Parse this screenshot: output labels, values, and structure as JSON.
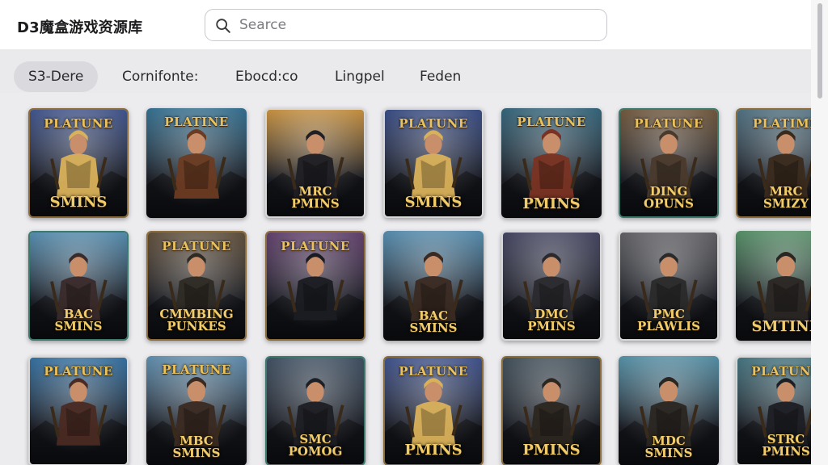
{
  "app": {
    "title": "D3魔盒游戏资源库"
  },
  "search": {
    "placeholder": "Searce",
    "value": ""
  },
  "tabs": [
    {
      "label": "S3-Dere",
      "active": true
    },
    {
      "label": "Cornifonte:",
      "active": false
    },
    {
      "label": "Ebocd:co",
      "active": false
    },
    {
      "label": "Lingpel",
      "active": false
    },
    {
      "label": "Feden",
      "active": false
    }
  ],
  "colors": {
    "accent_gold": "#e9c25d",
    "header_bg": "#ffffff",
    "page_bg": "#ececef",
    "active_tab_bg": "#dadade"
  },
  "cards": [
    {
      "top": "PLATUNE",
      "bottom": "SMINS",
      "hue": "#3b4f86",
      "hero": "#d9b15a"
    },
    {
      "top": "PLATINE",
      "bottom": "",
      "hue": "#2f6a8a",
      "hero": "#6b3b22"
    },
    {
      "top": "",
      "bottom": "MRC\nPMINS",
      "hue": "#c08a3a",
      "hero": "#1f1f24"
    },
    {
      "top": "PLATUNE",
      "bottom": "SMINS",
      "hue": "#34477e",
      "hero": "#d9b15a"
    },
    {
      "top": "PLATUNE",
      "bottom": "PMINS",
      "hue": "#2f5f74",
      "hero": "#7a3322"
    },
    {
      "top": "PLATUNE",
      "bottom": "DING\nOPUNS",
      "hue": "#6a5238",
      "hero": "#4a3a2c"
    },
    {
      "top": "PLATIME",
      "bottom": "MRC\nSMIZY",
      "hue": "#4a6a7a",
      "hero": "#3a2a1c"
    },
    {
      "top": "",
      "bottom": "BAC\nSMINS",
      "hue": "#4f86a8",
      "hero": "#3a2a2a"
    },
    {
      "top": "PLATUNE",
      "bottom": "CMMBING\nPUNKES",
      "hue": "#5a4a36",
      "hero": "#2e2a24"
    },
    {
      "top": "PLATUNE",
      "bottom": "",
      "hue": "#5b3b66",
      "hero": "#1a1c22"
    },
    {
      "top": "",
      "bottom": "BAC\nSMINS",
      "hue": "#4f86a8",
      "hero": "#3a2a22"
    },
    {
      "top": "",
      "bottom": "DMC\nPMINS",
      "hue": "#3e3f5a",
      "hero": "#2a2a2e"
    },
    {
      "top": "",
      "bottom": "PMC\nPLAWLIS",
      "hue": "#5a5a5e",
      "hero": "#2a2a2a"
    },
    {
      "top": "",
      "bottom": "SMTINE",
      "hue": "#4e8860",
      "hero": "#2a2624"
    },
    {
      "top": "PLATUNE",
      "bottom": "",
      "hue": "#2f6a9a",
      "hero": "#4a2a22"
    },
    {
      "top": "PLATUNE",
      "bottom": "MBC\nSMINS",
      "hue": "#5a88a8",
      "hero": "#3a2a22"
    },
    {
      "top": "",
      "bottom": "SMC\nPOMOG",
      "hue": "#3a4a5c",
      "hero": "#1e1f24"
    },
    {
      "top": "PLATUNE",
      "bottom": "PMINS",
      "hue": "#3a4d86",
      "hero": "#d9b15a"
    },
    {
      "top": "",
      "bottom": "PMINS",
      "hue": "#3c4a54",
      "hero": "#2c2620"
    },
    {
      "top": "",
      "bottom": "MDC\nSMINS",
      "hue": "#4f8aa0",
      "hero": "#2a2622"
    },
    {
      "top": "PLATUNE",
      "bottom": "STRC\nPMINS",
      "hue": "#3f6e7a",
      "hero": "#1e1f24"
    }
  ]
}
